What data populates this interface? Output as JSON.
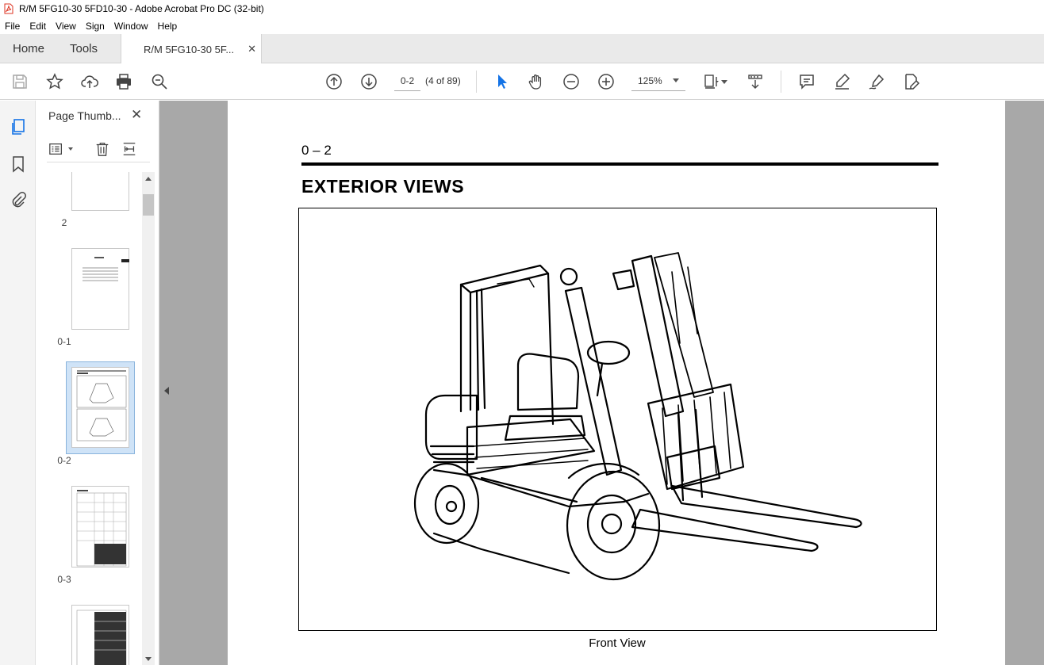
{
  "window": {
    "title": "R/M 5FG10-30 5FD10-30 - Adobe Acrobat Pro DC (32-bit)",
    "icon": "pdf-icon"
  },
  "menu": [
    "File",
    "Edit",
    "View",
    "Sign",
    "Window",
    "Help"
  ],
  "tabs": {
    "home": "Home",
    "tools": "Tools",
    "document": "R/M 5FG10-30 5F..."
  },
  "toolbar": {
    "page_field": "0-2",
    "page_count": "(4 of 89)",
    "zoom": "125%"
  },
  "panel": {
    "title": "Page Thumb..."
  },
  "thumbnails": [
    {
      "label": "2"
    },
    {
      "label": "0-1"
    },
    {
      "label": "0-2",
      "selected": true
    },
    {
      "label": "0-3"
    },
    {
      "label": ""
    }
  ],
  "document": {
    "page_number": "0 – 2",
    "heading": "EXTERIOR  VIEWS",
    "caption": "Front View"
  },
  "colors": {
    "accent": "#1473e6",
    "viewer_bg": "#a8a8a8",
    "selected_thumb": "#cfe3f7"
  }
}
